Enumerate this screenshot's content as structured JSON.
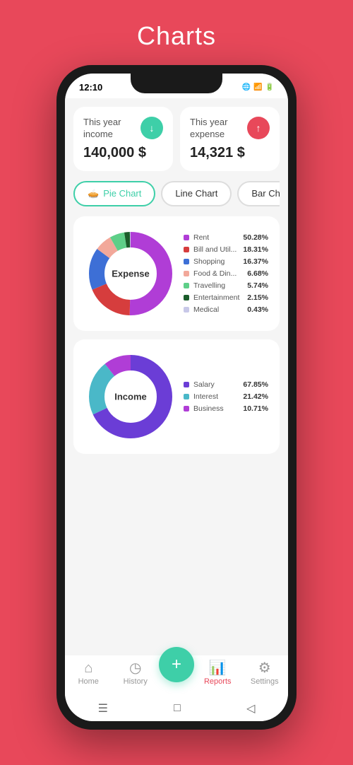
{
  "page": {
    "title": "Charts",
    "background_color": "#e8485a"
  },
  "status_bar": {
    "time": "12:10",
    "icons": "📶 🔋"
  },
  "summary_cards": [
    {
      "label": "This year income",
      "value": "140,000 $",
      "icon": "↓",
      "icon_color": "#3ecfa8"
    },
    {
      "label": "This year expense",
      "value": "14,321 $",
      "icon": "↑",
      "icon_color": "#e8485a"
    }
  ],
  "chart_tabs": [
    {
      "label": "Pie Chart",
      "active": true,
      "icon": "🥧"
    },
    {
      "label": "Line Chart",
      "active": false
    },
    {
      "label": "Bar Chart",
      "active": false
    }
  ],
  "expense_chart": {
    "title": "Expense",
    "legend": [
      {
        "name": "Rent",
        "pct": "50.28%",
        "color": "#b03dd6"
      },
      {
        "name": "Bill and Util...",
        "pct": "18.31%",
        "color": "#d63d3d"
      },
      {
        "name": "Shopping",
        "pct": "16.37%",
        "color": "#3d6fd6"
      },
      {
        "name": "Food & Din...",
        "pct": "6.68%",
        "color": "#f2a89a"
      },
      {
        "name": "Travelling",
        "pct": "5.74%",
        "color": "#5ecf88"
      },
      {
        "name": "Entertainment",
        "pct": "2.15%",
        "color": "#1a5c2a"
      },
      {
        "name": "Medical",
        "pct": "0.43%",
        "color": "#c8c8e8"
      }
    ],
    "segments": [
      {
        "color": "#b03dd6",
        "pct": 50.28
      },
      {
        "color": "#d63d3d",
        "pct": 18.31
      },
      {
        "color": "#3d6fd6",
        "pct": 16.37
      },
      {
        "color": "#f2a89a",
        "pct": 6.68
      },
      {
        "color": "#5ecf88",
        "pct": 5.74
      },
      {
        "color": "#1a5c2a",
        "pct": 2.15
      },
      {
        "color": "#c8c8e8",
        "pct": 0.43
      }
    ]
  },
  "income_chart": {
    "title": "Income",
    "legend": [
      {
        "name": "Salary",
        "pct": "67.85%",
        "color": "#6b3dd6"
      },
      {
        "name": "Interest",
        "pct": "21.42%",
        "color": "#4ab8c8"
      },
      {
        "name": "Business",
        "pct": "10.71%",
        "color": "#b03dd6"
      }
    ],
    "segments": [
      {
        "color": "#6b3dd6",
        "pct": 67.85
      },
      {
        "color": "#4ab8c8",
        "pct": 21.42
      },
      {
        "color": "#b03dd6",
        "pct": 10.71
      }
    ]
  },
  "nav": {
    "items": [
      {
        "label": "Home",
        "icon": "⌂",
        "active": false
      },
      {
        "label": "History",
        "icon": "◷",
        "active": false
      },
      {
        "label": "+",
        "fab": true
      },
      {
        "label": "Reports",
        "icon": "📊",
        "active": true
      },
      {
        "label": "Settings",
        "icon": "⚙",
        "active": false
      }
    ]
  }
}
